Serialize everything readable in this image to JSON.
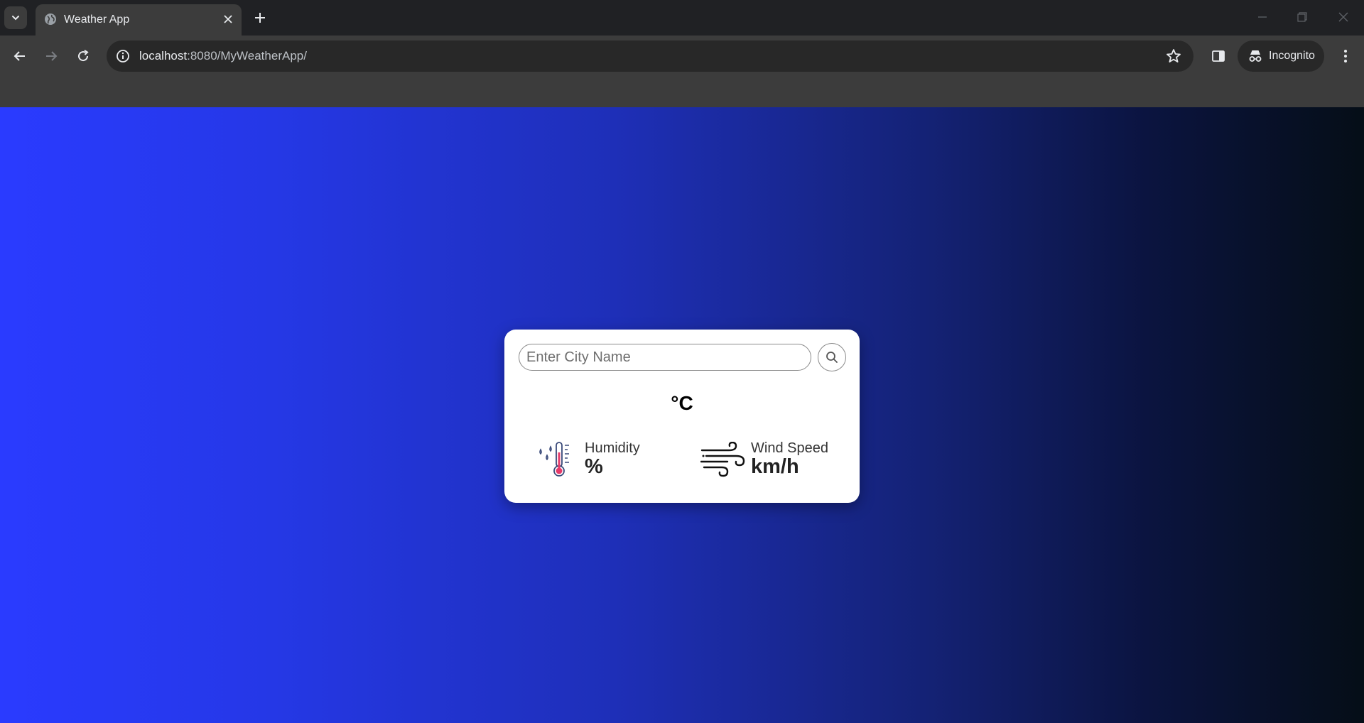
{
  "browser": {
    "tab_title": "Weather App",
    "url_host": "localhost",
    "url_rest": ":8080/MyWeatherApp/",
    "incognito_label": "Incognito",
    "icons": {
      "tab_search": "chevron-down-icon",
      "favicon": "globe-icon",
      "tab_close": "close-icon",
      "new_tab": "plus-icon",
      "back": "arrow-left-icon",
      "forward": "arrow-right-icon",
      "reload": "reload-icon",
      "site_info": "info-icon",
      "bookmark": "star-icon",
      "side_panel": "side-panel-icon",
      "incognito": "incognito-icon",
      "menu": "kebab-menu-icon",
      "minimize": "minimize-icon",
      "restore": "restore-icon",
      "close_window": "close-icon"
    }
  },
  "weather_card": {
    "search": {
      "placeholder": "Enter City Name",
      "value": "",
      "button_icon": "search-icon"
    },
    "temperature_unit": "°C",
    "humidity": {
      "label": "Humidity",
      "unit": "%",
      "icon": "humidity-thermometer-icon"
    },
    "wind": {
      "label": "Wind Speed",
      "unit": "km/h",
      "icon": "wind-icon"
    }
  },
  "colors": {
    "background_gradient": [
      "#2a3bff",
      "#1e2fb8",
      "#142275",
      "#050e17"
    ],
    "card_background": "#ffffff",
    "humidity_icon_accent": "#e63a6a",
    "humidity_icon_drops": "#3a4a7a"
  }
}
